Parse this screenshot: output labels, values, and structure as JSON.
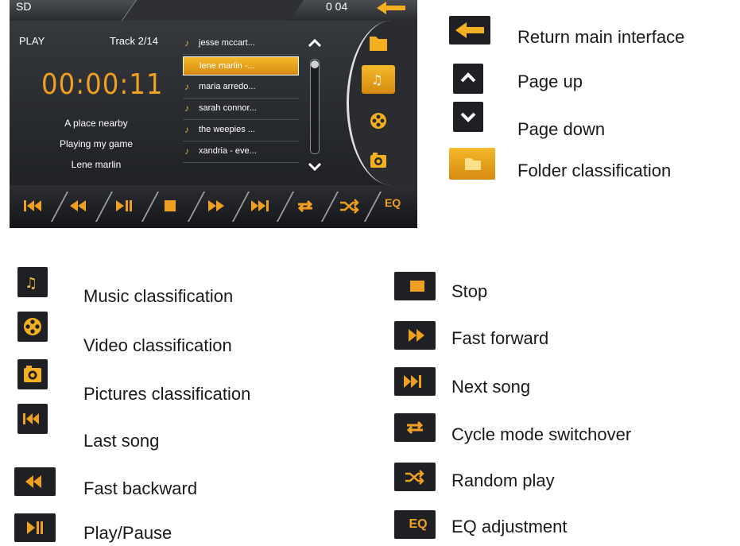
{
  "screen": {
    "source": "SD",
    "time": "0 04",
    "play_label": "PLAY",
    "track": "Track 2/14",
    "clock": "00:00:11",
    "song_title": "A place nearby",
    "album": "Playing my game",
    "artist": "Lene marlin",
    "playlist": [
      "jesse mccart...",
      "lene marlin -...",
      "maria arredo...",
      "sarah connor...",
      "the weepies ...",
      "xandria - eve..."
    ],
    "eq_label": "EQ"
  },
  "legend_right": [
    {
      "icon": "back-arrow-icon",
      "label": "Return main interface"
    },
    {
      "icon": "chevron-up-icon",
      "label": "Page up"
    },
    {
      "icon": "chevron-down-icon",
      "label": "Page down"
    },
    {
      "icon": "folder-icon",
      "label": "Folder classification"
    }
  ],
  "legend_left": [
    {
      "icon": "music-icon",
      "label": "Music classification"
    },
    {
      "icon": "film-reel-icon",
      "label": "Video classification"
    },
    {
      "icon": "camera-icon",
      "label": "Pictures classification"
    },
    {
      "icon": "previous-track-icon",
      "label": "Last song"
    },
    {
      "icon": "rewind-icon",
      "label": "Fast backward"
    },
    {
      "icon": "play-pause-icon",
      "label": "Play/Pause"
    }
  ],
  "legend_mid": [
    {
      "icon": "stop-icon",
      "label": "Stop"
    },
    {
      "icon": "fast-forward-icon",
      "label": "Fast forward"
    },
    {
      "icon": "next-track-icon",
      "label": "Next song"
    },
    {
      "icon": "repeat-icon",
      "label": "Cycle mode switchover"
    },
    {
      "icon": "shuffle-icon",
      "label": "Random play"
    },
    {
      "icon": "eq-icon",
      "label": "EQ adjustment",
      "icon_text": "EQ"
    }
  ],
  "colors": {
    "accent": "#f0a020",
    "panel": "#1e2024"
  }
}
